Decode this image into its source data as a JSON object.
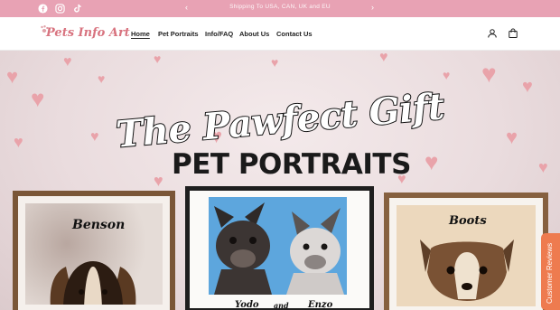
{
  "announcement": {
    "message": "Shipping To USA, CAN, UK and EU",
    "prev_arrow": "‹",
    "next_arrow": "›",
    "social_icons": [
      "facebook-icon",
      "instagram-icon",
      "tiktok-icon"
    ]
  },
  "header": {
    "logo_text": "Pets Info Art",
    "nav": [
      {
        "label": "Home",
        "active": true
      },
      {
        "label": "Pet Portraits",
        "active": false
      },
      {
        "label": "Info/FAQ",
        "active": false
      },
      {
        "label": "About Us",
        "active": false
      },
      {
        "label": "Contact Us",
        "active": false
      }
    ],
    "icons": [
      "account-icon",
      "cart-icon"
    ]
  },
  "hero": {
    "title": "The Pawfect Gift",
    "subtitle": "PET PORTRAITS",
    "portraits": {
      "left_name": "Benson",
      "center_names": [
        "Yodo",
        "and",
        "Enzo"
      ],
      "right_name": "Boots"
    }
  },
  "reviews_tab": {
    "label": "Customer Reviews",
    "star": "★"
  },
  "colors": {
    "announcement_bg": "#e8a2b4",
    "logo": "#d8737f",
    "hearts": "#e9a3aa",
    "reviews_tab": "#ee7b4f"
  }
}
